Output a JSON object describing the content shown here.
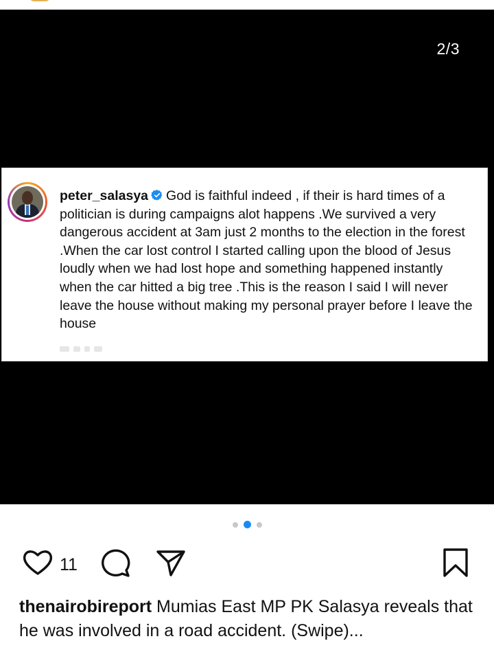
{
  "post": {
    "slide_counter": "2/3",
    "slide_indicator": {
      "total": 3,
      "active": 2
    }
  },
  "screenshot_card": {
    "username": "peter_salasya",
    "caption": "God is faithful indeed , if their is hard times of a politician is during campaigns alot happens .We survived a very dangerous accident at 3am just 2 months to the election in the forest .When the car lost control I started calling upon the blood of Jesus loudly when we had lost hope and something happened instantly when the car hitted a big tree .This is the reason I said I will never leave the house without making my personal prayer before I leave the house"
  },
  "actions": {
    "like_count": "11",
    "icons": [
      "heart-icon",
      "comment-icon",
      "share-icon",
      "bookmark-icon"
    ]
  },
  "caption": {
    "author": "thenairobireport",
    "text": "Mumias East MP PK Salasya reveals that he was involved in a road accident. (Swipe)...",
    "more": "…"
  },
  "colors": {
    "media_background": "#000000",
    "active_dot": "#1a8cf0",
    "inactive_dot": "#c8c8c8",
    "verified_badge": "#1a8cf0"
  }
}
